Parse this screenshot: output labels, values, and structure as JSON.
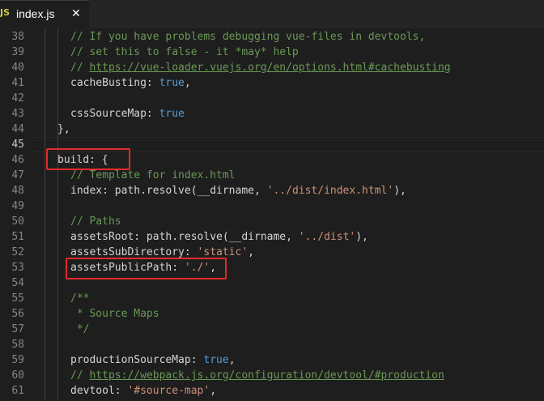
{
  "tab": {
    "icon": "JS",
    "title": "index.js",
    "close": "✕"
  },
  "editor": {
    "lines": [
      {
        "n": "38",
        "indent": 1,
        "tokens": [
          {
            "t": "// If you have problems debugging vue-files in devtools,",
            "c": "com"
          }
        ]
      },
      {
        "n": "39",
        "indent": 1,
        "tokens": [
          {
            "t": "// set this to false - it *may* help",
            "c": "com"
          }
        ]
      },
      {
        "n": "40",
        "indent": 1,
        "tokens": [
          {
            "t": "// ",
            "c": "com"
          },
          {
            "t": "https://vue-loader.vuejs.org/en/options.html#cachebusting",
            "c": "link"
          }
        ]
      },
      {
        "n": "41",
        "indent": 1,
        "tokens": [
          {
            "t": "cacheBusting",
            "c": "key"
          },
          {
            "t": ": ",
            "c": "punc"
          },
          {
            "t": "true",
            "c": "bool"
          },
          {
            "t": ",",
            "c": "punc"
          }
        ]
      },
      {
        "n": "42",
        "indent": 0,
        "tokens": []
      },
      {
        "n": "43",
        "indent": 1,
        "tokens": [
          {
            "t": "cssSourceMap",
            "c": "key"
          },
          {
            "t": ": ",
            "c": "punc"
          },
          {
            "t": "true",
            "c": "bool"
          }
        ]
      },
      {
        "n": "44",
        "indent": 0.5,
        "tokens": [
          {
            "t": "},",
            "c": "punc"
          }
        ]
      },
      {
        "n": "45",
        "indent": 0,
        "tokens": [],
        "active": true
      },
      {
        "n": "46",
        "indent": 0.5,
        "tokens": [
          {
            "t": "build",
            "c": "key"
          },
          {
            "t": ": {",
            "c": "punc"
          }
        ]
      },
      {
        "n": "47",
        "indent": 1,
        "tokens": [
          {
            "t": "// Template for index.html",
            "c": "com"
          }
        ]
      },
      {
        "n": "48",
        "indent": 1,
        "tokens": [
          {
            "t": "index",
            "c": "key"
          },
          {
            "t": ": path.resolve(__dirname, ",
            "c": "punc"
          },
          {
            "t": "'../dist/index.html'",
            "c": "str"
          },
          {
            "t": "),",
            "c": "punc"
          }
        ]
      },
      {
        "n": "49",
        "indent": 0,
        "tokens": []
      },
      {
        "n": "50",
        "indent": 1,
        "tokens": [
          {
            "t": "// Paths",
            "c": "com"
          }
        ]
      },
      {
        "n": "51",
        "indent": 1,
        "tokens": [
          {
            "t": "assetsRoot",
            "c": "key"
          },
          {
            "t": ": path.resolve(__dirname, ",
            "c": "punc"
          },
          {
            "t": "'../dist'",
            "c": "str"
          },
          {
            "t": "),",
            "c": "punc"
          }
        ]
      },
      {
        "n": "52",
        "indent": 1,
        "tokens": [
          {
            "t": "assetsSubDirectory",
            "c": "key"
          },
          {
            "t": ": ",
            "c": "punc"
          },
          {
            "t": "'static'",
            "c": "str"
          },
          {
            "t": ",",
            "c": "punc"
          }
        ]
      },
      {
        "n": "53",
        "indent": 1,
        "tokens": [
          {
            "t": "assetsPublicPath",
            "c": "key"
          },
          {
            "t": ": ",
            "c": "punc"
          },
          {
            "t": "'./'",
            "c": "str"
          },
          {
            "t": ",",
            "c": "punc"
          }
        ]
      },
      {
        "n": "54",
        "indent": 0,
        "tokens": []
      },
      {
        "n": "55",
        "indent": 1,
        "tokens": [
          {
            "t": "/**",
            "c": "com"
          }
        ]
      },
      {
        "n": "56",
        "indent": 1,
        "tokens": [
          {
            "t": " * Source Maps",
            "c": "com"
          }
        ]
      },
      {
        "n": "57",
        "indent": 1,
        "tokens": [
          {
            "t": " */",
            "c": "com"
          }
        ]
      },
      {
        "n": "58",
        "indent": 0,
        "tokens": []
      },
      {
        "n": "59",
        "indent": 1,
        "tokens": [
          {
            "t": "productionSourceMap",
            "c": "key"
          },
          {
            "t": ": ",
            "c": "punc"
          },
          {
            "t": "true",
            "c": "bool"
          },
          {
            "t": ",",
            "c": "punc"
          }
        ]
      },
      {
        "n": "60",
        "indent": 1,
        "tokens": [
          {
            "t": "// ",
            "c": "com"
          },
          {
            "t": "https://webpack.js.org/configuration/devtool/#production",
            "c": "link"
          }
        ]
      },
      {
        "n": "61",
        "indent": 1,
        "tokens": [
          {
            "t": "devtool",
            "c": "key"
          },
          {
            "t": ": ",
            "c": "punc"
          },
          {
            "t": "'#source-map'",
            "c": "str"
          },
          {
            "t": ",",
            "c": "punc"
          }
        ]
      }
    ]
  },
  "colors": {
    "background": "#1e1e1e",
    "comment": "#6a9955",
    "string": "#ce9178",
    "keyword": "#569cd6",
    "highlight_box": "#e32b2b"
  }
}
